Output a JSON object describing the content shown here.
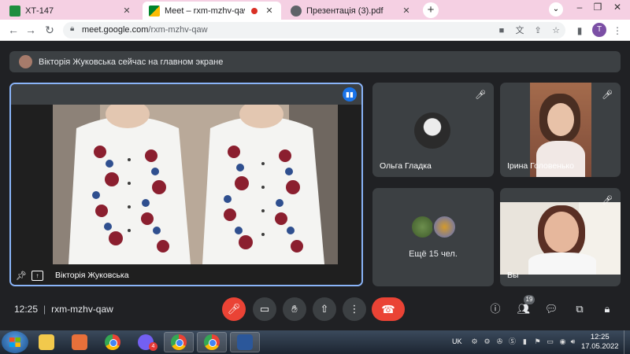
{
  "browser": {
    "tabs": [
      {
        "title": "ХТ-147",
        "active": false,
        "icon": "classroom-icon"
      },
      {
        "title": "Meet – rxm-mzhv-qaw",
        "active": true,
        "icon": "meet-icon"
      },
      {
        "title": "Презентація (3).pdf",
        "active": false,
        "icon": "globe-icon"
      }
    ],
    "url_host": "meet.google.com",
    "url_path": "/rxm-mzhv-qaw",
    "profile_initial": "T"
  },
  "meet": {
    "banner_text": "Вікторія Жуковська сейчас на главном экране",
    "main_presenter": "Вікторія Жуковська",
    "participants": [
      {
        "name": "Ольга Гладка"
      },
      {
        "name": "Ірина Головенько"
      },
      {
        "name": "Ещё 15 чел."
      },
      {
        "name": "Вы"
      }
    ],
    "meeting_time": "12:25",
    "meeting_code": "rxm-mzhv-qaw",
    "people_count": "19"
  },
  "taskbar": {
    "language": "UK",
    "clock_time": "12:25",
    "clock_date": "17.05.2022",
    "viber_badge": "4"
  },
  "colors": {
    "accent_blue": "#8ab4f8",
    "speaking_blue": "#1a73e8",
    "danger_red": "#ea4335",
    "surface": "#3c4043",
    "background": "#202124",
    "tabbar_pink": "#f5d0e3"
  }
}
